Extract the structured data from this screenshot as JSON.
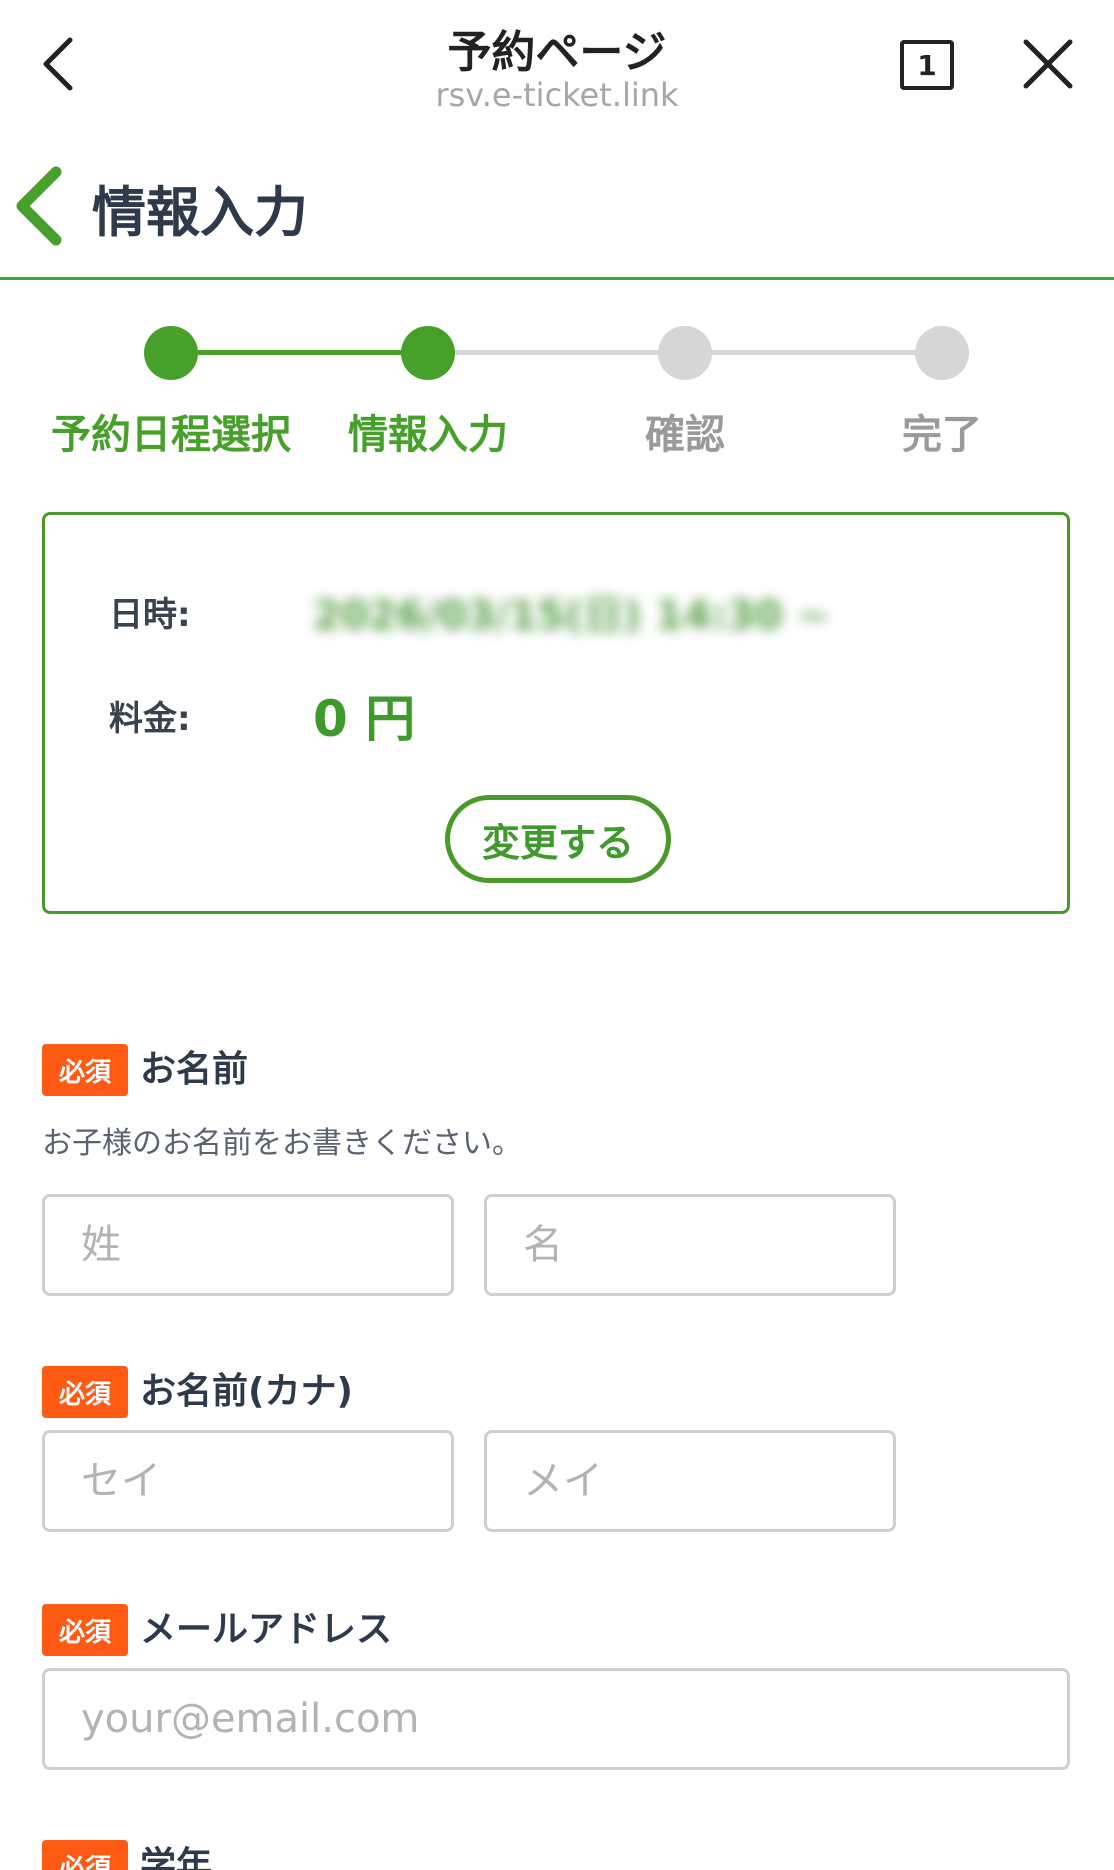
{
  "browser": {
    "title": "予約ページ",
    "url": "rsv.e-ticket.link",
    "tab_count": "1"
  },
  "header": {
    "title": "情報入力"
  },
  "stepper": {
    "steps": [
      {
        "label": "予約日程選択",
        "state": "completed"
      },
      {
        "label": "情報入力",
        "state": "current"
      },
      {
        "label": "確認",
        "state": "pending"
      },
      {
        "label": "完了",
        "state": "pending"
      }
    ],
    "active_color": "#46a02a",
    "inactive_color": "#d6d6d6"
  },
  "summary": {
    "date_label": "日時:",
    "date_value": "2026/03/15(日) 14:30 ~",
    "price_label": "料金:",
    "price_value": "0 円",
    "change_button": "変更する"
  },
  "form": {
    "required_badge": "必須",
    "name": {
      "label": "お名前",
      "hint": "お子様のお名前をお書きください。",
      "last_placeholder": "姓",
      "first_placeholder": "名"
    },
    "kana": {
      "label": "お名前(カナ)",
      "last_placeholder": "セイ",
      "first_placeholder": "メイ"
    },
    "email": {
      "label": "メールアドレス",
      "placeholder": "your@email.com"
    },
    "grade": {
      "label": "学年"
    }
  },
  "colors": {
    "brand_green": "#46a02a",
    "required_orange": "#ff5a14"
  }
}
